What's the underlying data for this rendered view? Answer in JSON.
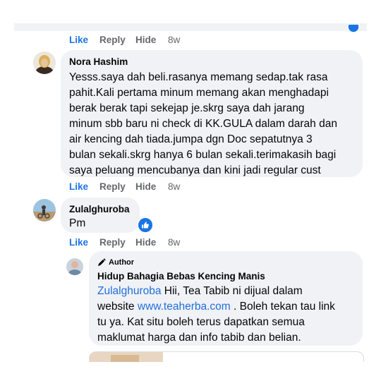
{
  "colors": {
    "accent": "#1b74e4",
    "bubble": "#f0f2f5",
    "muted": "#65676b",
    "link": "#216fdb"
  },
  "actions": {
    "like": "Like",
    "reply": "Reply",
    "hide": "Hide",
    "time": "8w"
  },
  "comments": [
    {
      "author": "Nora Hashim",
      "lines": [
        "Yesss.saya dah beli.rasanya memang sedap.tak rasa",
        "pahit.Kali pertama minum memang akan menghadapi",
        "berak berak tapi sekejap je.skrg saya dah jarang",
        "minum sbb baru ni check di KK.GULA dalam darah dan",
        "air kencing dah tiada.jumpa dgn Doc sepatutnya 3",
        "bulan sekali.skrg hanya 6 bulan sekali.terimakasih bagi",
        "saya peluang mencubanya dan kini jadi regular cust"
      ]
    },
    {
      "author": "Zulalghuroba",
      "text": "Pm",
      "reaction": "like-icon"
    }
  ],
  "reply": {
    "badge": "Author",
    "author": "Hidup Bahagia Bebas Kencing Manis",
    "tag": "Zulalghuroba",
    "line1": " Hii, Tea Tabib ni dijual dalam",
    "line2_pre": "website ",
    "link": "www.teaherba.com",
    "line2_post": " . Boleh tekan tau link",
    "line3": "tu ya. Kat situ boleh terus dapatkan semua",
    "line4": "maklumat harga dan info tabib dan belian."
  }
}
